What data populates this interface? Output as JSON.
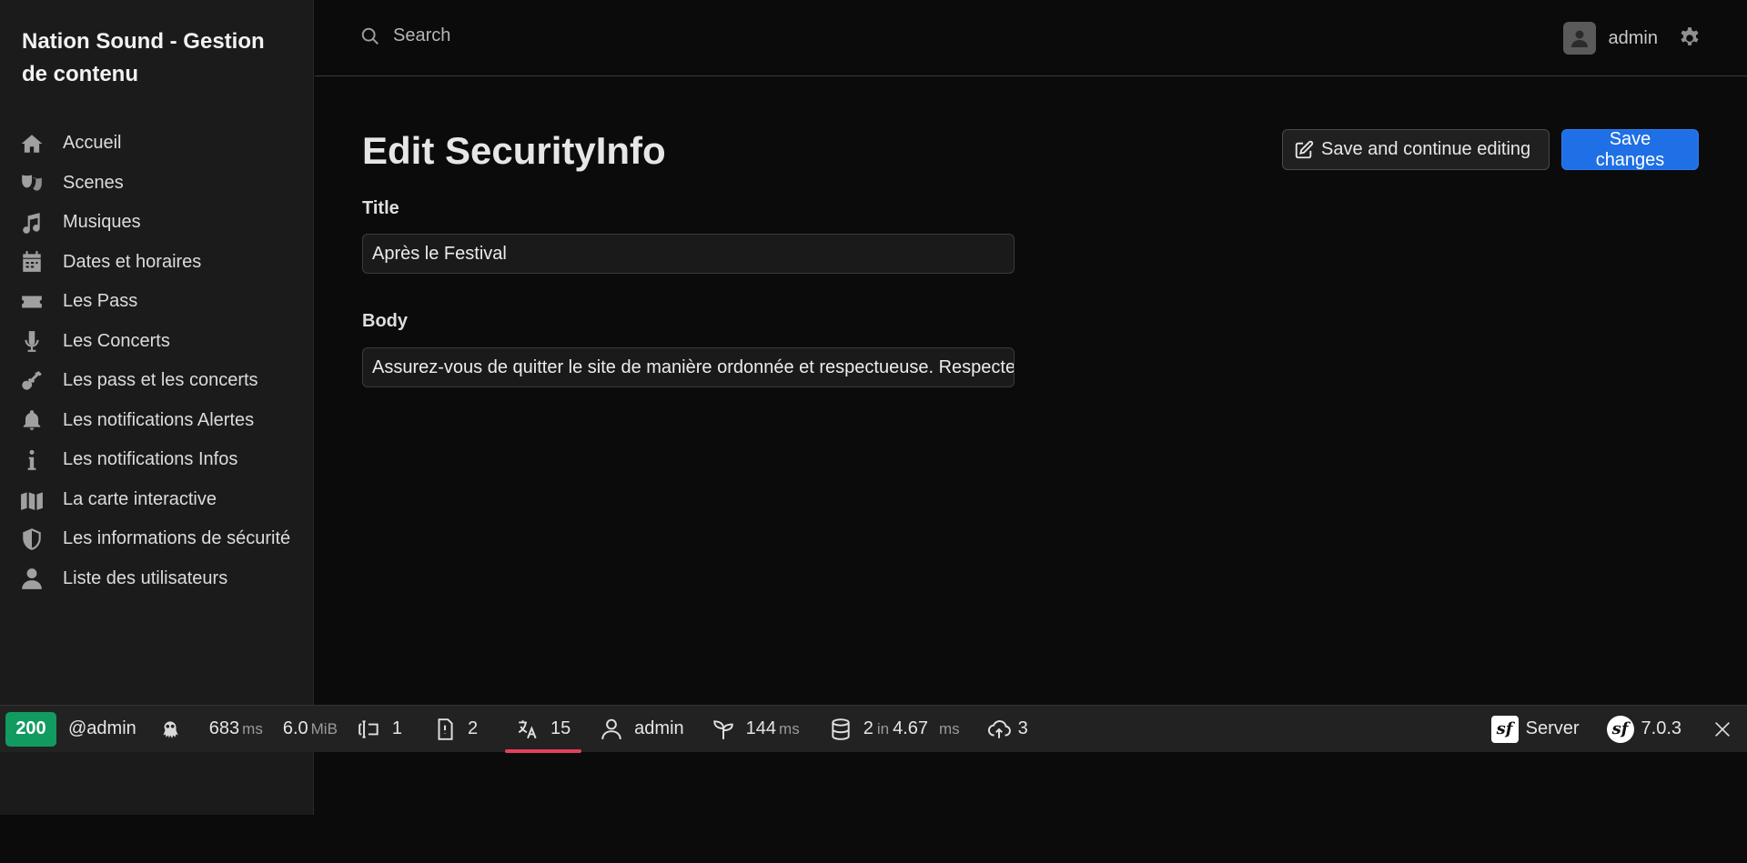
{
  "sidebar": {
    "brand": "Nation Sound - Gestion de contenu",
    "items": [
      {
        "label": "Accueil",
        "icon": "home-icon"
      },
      {
        "label": "Scenes",
        "icon": "theater-masks-icon"
      },
      {
        "label": "Musiques",
        "icon": "music-icon"
      },
      {
        "label": "Dates et horaires",
        "icon": "calendar-icon"
      },
      {
        "label": "Les Pass",
        "icon": "ticket-icon"
      },
      {
        "label": "Les Concerts",
        "icon": "microphone-icon"
      },
      {
        "label": "Les pass et les concerts",
        "icon": "guitar-icon"
      },
      {
        "label": "Les notifications Alertes",
        "icon": "bell-icon"
      },
      {
        "label": "Les notifications Infos",
        "icon": "info-icon"
      },
      {
        "label": "La carte interactive",
        "icon": "map-icon"
      },
      {
        "label": "Les informations de sécurité",
        "icon": "shield-icon"
      },
      {
        "label": "Liste des utilisateurs",
        "icon": "user-icon"
      }
    ]
  },
  "header": {
    "search_label": "Search",
    "username": "admin"
  },
  "main": {
    "title": "Edit SecurityInfo",
    "save_continue_label": "Save and continue editing",
    "save_label": "Save changes",
    "fields": {
      "title_label": "Title",
      "title_value": "Après le Festival",
      "body_label": "Body",
      "body_value": "Assurez-vous de quitter le site de manière ordonnée et respectueuse. Respectez"
    }
  },
  "toolbar": {
    "status": "200",
    "user": "@admin",
    "time_value": "683",
    "time_unit": "ms",
    "memory_value": "6.0",
    "memory_unit": "MiB",
    "forms": "1",
    "logs": "2",
    "translations": "15",
    "security_user": "admin",
    "twig_value": "144",
    "twig_unit": "ms",
    "db_queries": "2",
    "db_in": "in",
    "db_time": "4.67",
    "db_unit": "ms",
    "uploads": "3",
    "server_label": "Server",
    "version": "7.0.3",
    "colors": {
      "status_ok": "#129b60",
      "active_underline": "#e2405f"
    }
  }
}
